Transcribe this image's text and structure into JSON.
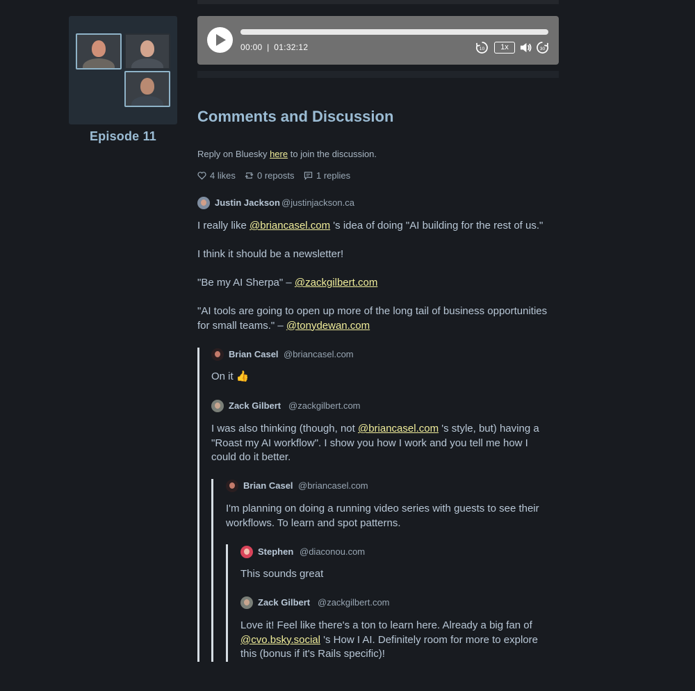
{
  "episode": {
    "title": "Episode 11"
  },
  "player": {
    "current_time": "00:00",
    "separator": "|",
    "duration": "01:32:12",
    "progress": 0,
    "speed_label": "1x",
    "icons": [
      "play-icon",
      "rewind-10-icon",
      "volume-icon",
      "forward-30-icon"
    ]
  },
  "discussion": {
    "heading": "Comments and Discussion",
    "reply_prefix": "Reply on Bluesky",
    "reply_link": "here",
    "reply_suffix": "to join the discussion.",
    "likes": "4 likes",
    "reposts": "0 reposts",
    "replies": "1 replies"
  },
  "comments": {
    "c1": {
      "author": "Justin Jackson",
      "handle": "@justinjackson.ca",
      "p1_a": "I really like ",
      "p1_link": "@briancasel.com",
      "p1_b": " 's idea of doing \"AI building for the rest of us.\"",
      "p2": "I think it should be a newsletter!",
      "p3_a": "\"Be my AI Sherpa\" – ",
      "p3_link": "@zackgilbert.com",
      "p4_a": "\"AI tools are going to open up more of the long tail of business opportunities for small teams.\" – ",
      "p4_link": "@tonydewan.com"
    },
    "c2": {
      "author": "Brian Casel",
      "handle": "@briancasel.com",
      "text": "On it 👍"
    },
    "c3": {
      "author": "Zack Gilbert",
      "handle": "@zackgilbert.com",
      "t_a": "I was also thinking (though, not ",
      "t_link": "@briancasel.com",
      "t_b": " 's style, but) having a \"Roast my AI workflow\". I show you how I work and you tell me how I could do it better."
    },
    "c4": {
      "author": "Brian Casel",
      "handle": "@briancasel.com",
      "text": "I'm planning on doing a running video series with guests to see their workflows.  To learn and spot patterns."
    },
    "c5": {
      "author": "Stephen",
      "handle": "@diaconou.com",
      "text": "This sounds great"
    },
    "c6": {
      "author": "Zack Gilbert",
      "handle": "@zackgilbert.com",
      "t_a": "Love it! Feel like there's a ton to learn here. Already a big fan of ",
      "t_link": "@cvo.bsky.social",
      "t_b": " 's How I AI. Definitely room for more to explore this (bonus if it's Rails specific)!"
    }
  },
  "colors": {
    "background": "#181b20",
    "accent_heading": "#9bbcd4",
    "link": "#f0ed9a",
    "player_bg": "#707070"
  }
}
